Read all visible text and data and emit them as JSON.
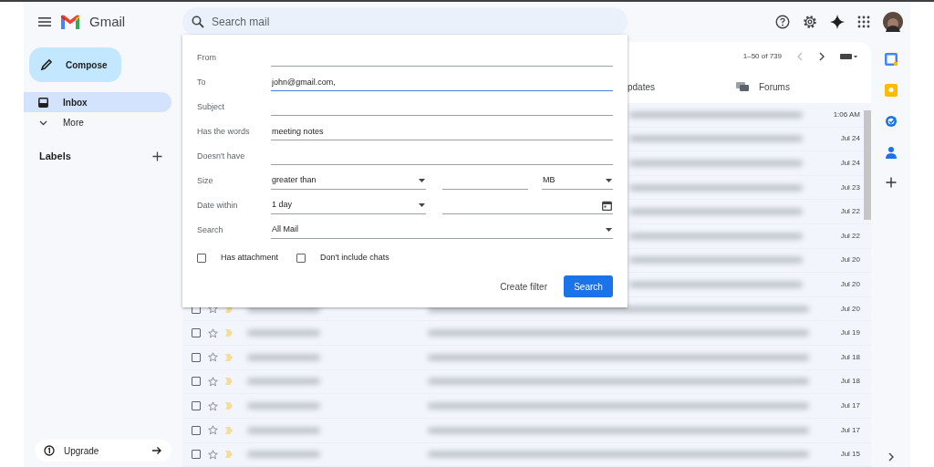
{
  "header": {
    "app_name": "Gmail",
    "search": {
      "placeholder": "Search mail"
    }
  },
  "sidebar": {
    "compose": "Compose",
    "items": [
      {
        "label": "Inbox",
        "kind": "inbox",
        "selected": true
      },
      {
        "label": "More",
        "kind": "more",
        "selected": false
      }
    ],
    "labels_heading": "Labels",
    "upgrade": "Upgrade"
  },
  "mail_list": {
    "range": "1–50 of 739",
    "tabs": [
      {
        "label": "pdates",
        "kind": "updates"
      },
      {
        "label": "Forums",
        "kind": "forums"
      }
    ],
    "rows": [
      {
        "date": "1:06 AM"
      },
      {
        "date": "Jul 24"
      },
      {
        "date": "Jul 24"
      },
      {
        "date": "Jul 23"
      },
      {
        "date": "Jul 22"
      },
      {
        "date": "Jul 22"
      },
      {
        "date": "Jul 20"
      },
      {
        "date": "Jul 20"
      },
      {
        "date": "Jul 20",
        "checked": false,
        "starred": false
      },
      {
        "date": "Jul 19",
        "checked": false,
        "starred": false
      },
      {
        "date": "Jul 18",
        "checked": false,
        "starred": false
      },
      {
        "date": "Jul 18",
        "checked": false,
        "starred": false
      },
      {
        "date": "Jul 17",
        "checked": false,
        "starred": false
      },
      {
        "date": "Jul 17",
        "checked": false,
        "starred": false
      },
      {
        "date": "Jul 15",
        "checked": false,
        "starred": false
      }
    ]
  },
  "search_dialog": {
    "fields": [
      {
        "kind": "text",
        "label": "From"
      },
      {
        "kind": "text",
        "label": "To",
        "value": "john@gmail.com,",
        "focused": true
      },
      {
        "kind": "text",
        "label": "Subject"
      },
      {
        "kind": "text",
        "label": "Has the words",
        "value": "meeting notes"
      },
      {
        "kind": "text",
        "label": "Doesn't have"
      },
      {
        "kind": "size",
        "label": "Size",
        "operator": "greater than",
        "unit": "MB"
      },
      {
        "kind": "date",
        "label": "Date within",
        "value": "1 day"
      },
      {
        "kind": "select",
        "label": "Search",
        "value": "All Mail"
      }
    ],
    "checkboxes": [
      {
        "label": "Has attachment",
        "checked": false
      },
      {
        "label": "Don't include chats",
        "checked": false
      }
    ],
    "create_filter": "Create filter",
    "search_button": "Search"
  }
}
